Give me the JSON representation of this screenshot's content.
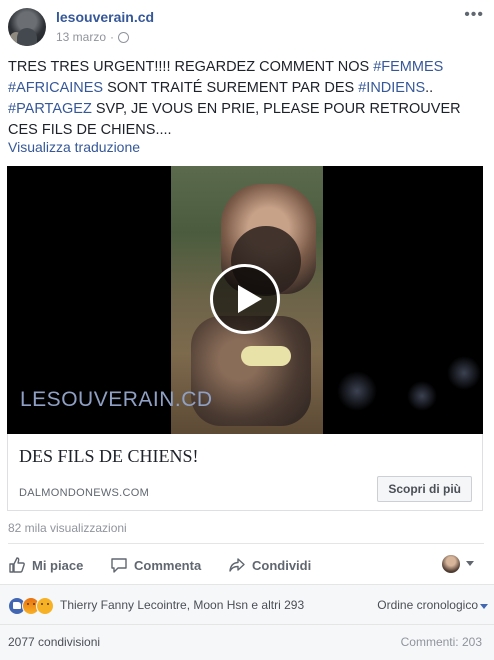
{
  "post": {
    "page_name": "lesouverain.cd",
    "date": "13 marzo",
    "dot": "·",
    "more_label": "•••",
    "text_segments": [
      {
        "text": "TRES TRES URGENT!!!! REGARDEZ COMMENT NOS ",
        "tag": false
      },
      {
        "text": "#FEMMES",
        "tag": true
      },
      {
        "text": " ",
        "tag": false
      },
      {
        "text": "#AFRICAINES",
        "tag": true
      },
      {
        "text": " SONT TRAITÉ SUREMENT PAR DES ",
        "tag": false
      },
      {
        "text": "#INDIENS",
        "tag": true
      },
      {
        "text": ".. ",
        "tag": false
      },
      {
        "text": "#PARTAGEZ",
        "tag": true
      },
      {
        "text": " SVP, JE VOUS EN PRIE, PLEASE POUR RETROUVER CES FILS DE CHIENS....",
        "tag": false
      }
    ],
    "translate_link": "Visualizza traduzione"
  },
  "video": {
    "watermark": "LESOUVERAIN.CD"
  },
  "link_preview": {
    "title": "DES FILS DE CHIENS!",
    "domain": "DALMONDONEWS.COM",
    "button_label": "Scopri di più"
  },
  "stats": {
    "views": "82 mila visualizzazioni",
    "reaction_names": "Thierry Fanny Lecointre, Moon Hsn e altri 293",
    "order_label": "Ordine cronologico",
    "shares": "2077 condivisioni",
    "comments": "Commenti: 203"
  },
  "actions": {
    "like": "Mi piace",
    "comment": "Commenta",
    "share": "Condividi"
  },
  "colors": {
    "link": "#365899",
    "like_blue": "#4267b2",
    "meta_gray": "#90949c"
  },
  "icons": [
    "globe-icon",
    "more-icon",
    "play-icon",
    "like-icon",
    "comment-icon",
    "share-icon",
    "reaction-like-icon",
    "reaction-angry-icon",
    "reaction-sad-icon",
    "chevron-down-icon"
  ]
}
